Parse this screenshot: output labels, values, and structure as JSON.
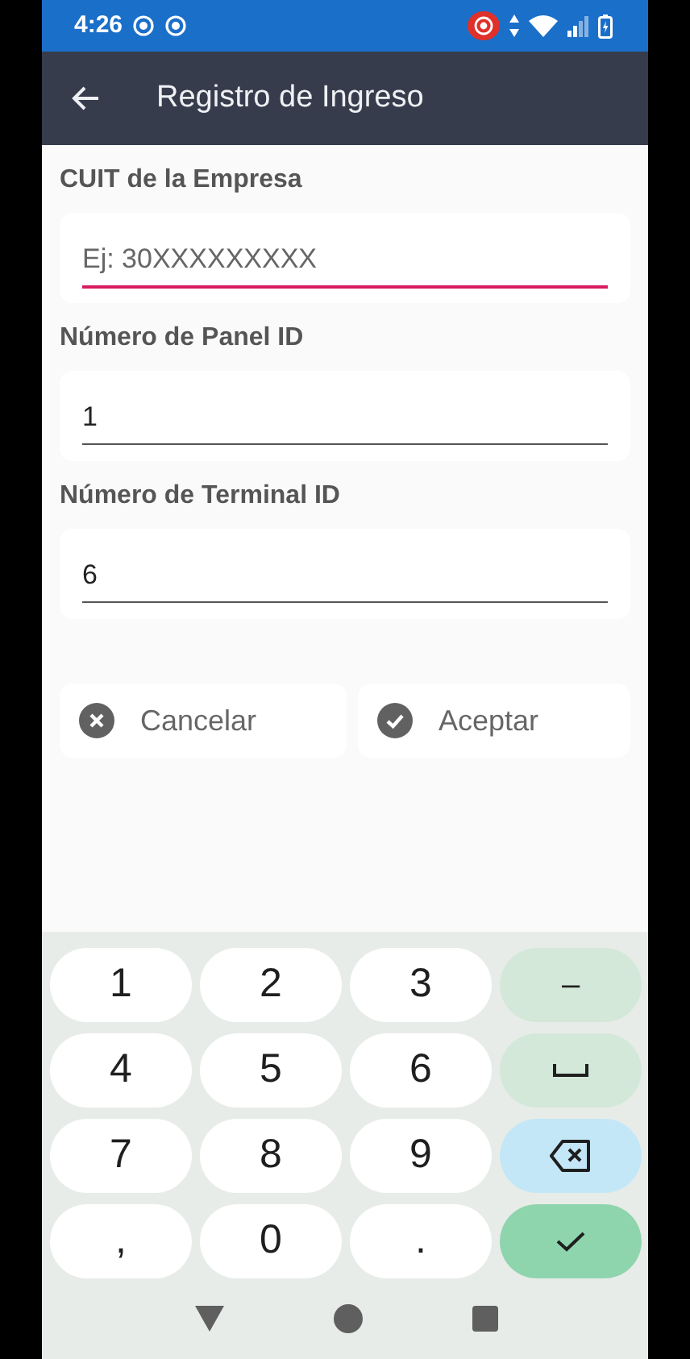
{
  "status_bar": {
    "time": "4:26"
  },
  "app_bar": {
    "title": "Registro de Ingreso"
  },
  "fields": [
    {
      "label": "CUIT de la Empresa",
      "placeholder": "Ej: 30XXXXXXXXX",
      "focused": true
    },
    {
      "label": "Número de Panel ID",
      "value": "1",
      "focused": false
    },
    {
      "label": "Número de Terminal ID",
      "value": "6",
      "focused": false
    }
  ],
  "buttons": [
    {
      "label": "Cancelar",
      "kind": "cancel"
    },
    {
      "label": "Aceptar",
      "kind": "accept"
    }
  ],
  "keyboard": {
    "keys": [
      {
        "kind": "char",
        "label": "1"
      },
      {
        "kind": "char",
        "label": "2"
      },
      {
        "kind": "char",
        "label": "3"
      },
      {
        "kind": "symbol",
        "label": "–"
      },
      {
        "kind": "char",
        "label": "4"
      },
      {
        "kind": "char",
        "label": "5"
      },
      {
        "kind": "char",
        "label": "6"
      },
      {
        "kind": "space"
      },
      {
        "kind": "char",
        "label": "7"
      },
      {
        "kind": "char",
        "label": "8"
      },
      {
        "kind": "char",
        "label": "9"
      },
      {
        "kind": "backspace"
      },
      {
        "kind": "char",
        "label": ","
      },
      {
        "kind": "char",
        "label": "0"
      },
      {
        "kind": "char",
        "label": "."
      },
      {
        "kind": "enter"
      }
    ]
  }
}
